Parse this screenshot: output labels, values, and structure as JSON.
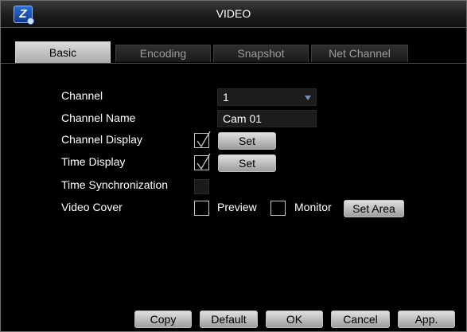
{
  "window": {
    "title": "VIDEO"
  },
  "tabs": [
    {
      "label": "Basic",
      "active": true
    },
    {
      "label": "Encoding",
      "active": false
    },
    {
      "label": "Snapshot",
      "active": false
    },
    {
      "label": "Net Channel",
      "active": false
    }
  ],
  "form": {
    "channel_label": "Channel",
    "channel_value": "1",
    "channel_name_label": "Channel Name",
    "channel_name_value": "Cam 01",
    "channel_display_label": "Channel Display",
    "channel_display_checked": true,
    "channel_display_set": "Set",
    "time_display_label": "Time Display",
    "time_display_checked": true,
    "time_display_set": "Set",
    "time_sync_label": "Time Synchronization",
    "time_sync_checked": false,
    "video_cover_label": "Video Cover",
    "preview_label": "Preview",
    "monitor_label": "Monitor",
    "set_area_label": "Set Area"
  },
  "buttons": {
    "copy": "Copy",
    "default": "Default",
    "ok": "OK",
    "cancel": "Cancel",
    "apply": "App."
  },
  "colors": {
    "background": "#000000",
    "text": "#ffffff",
    "button_face": "#cfcfcf",
    "dropdown_arrow": "#7e8bb6"
  }
}
